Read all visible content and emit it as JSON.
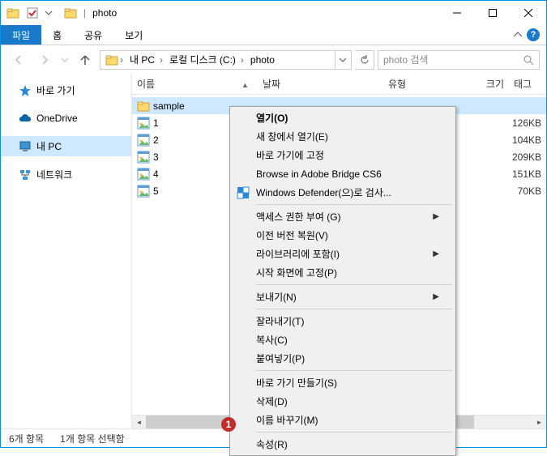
{
  "window": {
    "title": "photo"
  },
  "tabs": {
    "file": "파일",
    "home": "홈",
    "share": "공유",
    "view": "보기"
  },
  "breadcrumbs": {
    "pc": "내 PC",
    "disk": "로컬 디스크 (C:)",
    "folder": "photo"
  },
  "search": {
    "placeholder": "photo 검색"
  },
  "sidebar": {
    "quick": "바로 가기",
    "onedrive": "OneDrive",
    "pc": "내 PC",
    "network": "네트워크"
  },
  "columns": {
    "name": "이름",
    "date": "날짜",
    "type": "유형",
    "size": "크기",
    "tag": "태그"
  },
  "files": {
    "folder": {
      "name": "sample"
    },
    "f1": {
      "name": "1",
      "size": "126KB"
    },
    "f2": {
      "name": "2",
      "size": "104KB"
    },
    "f3": {
      "name": "3",
      "size": "209KB"
    },
    "f4": {
      "name": "4",
      "size": "151KB"
    },
    "f5": {
      "name": "5",
      "size": "70KB"
    }
  },
  "status": {
    "count": "6개 항목",
    "selected": "1개 항목 선택함"
  },
  "ctx": {
    "open": "열기(O)",
    "newwin": "새 창에서 열기(E)",
    "pinquick": "바로 가기에 고정",
    "bridge": "Browse in Adobe Bridge CS6",
    "defender": "Windows Defender(으)로 검사...",
    "access": "액세스 권한 부여 (G)",
    "restore": "이전 버전 복원(V)",
    "library": "라이브러리에 포함(I)",
    "pinstart": "시작 화면에 고정(P)",
    "sendto": "보내기(N)",
    "cut": "잘라내기(T)",
    "copy": "복사(C)",
    "paste": "붙여넣기(P)",
    "shortcut": "바로 가기 만들기(S)",
    "delete": "삭제(D)",
    "rename": "이름 바꾸기(M)",
    "props": "속성(R)"
  },
  "annot": {
    "num": "1"
  }
}
